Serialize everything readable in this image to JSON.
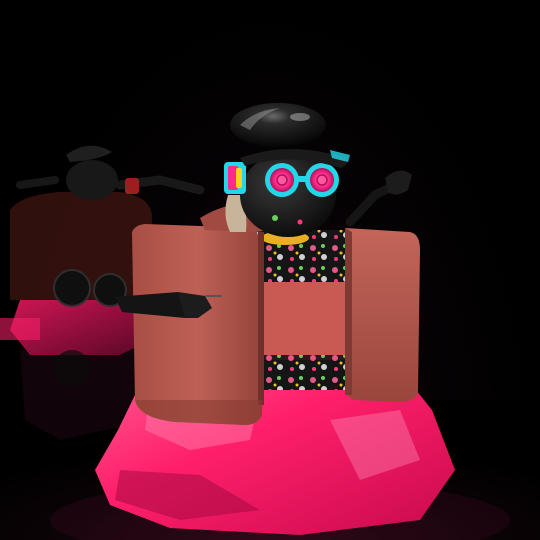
{
  "scene": {
    "background": "#000000",
    "floor_color": "#0a0a0a",
    "reflection_color": "#1a0a12"
  },
  "figure": {
    "cap_color": "#1a1a1a",
    "goggle_ring_color": "#22d8e8",
    "goggle_lens_color": "#ff2a8a",
    "visor_accent": [
      "#22d8e8",
      "#ff2a8a",
      "#ffd020"
    ],
    "jacket_color": "#b4574d",
    "jacket_shadow": "#7e3a33",
    "shirt_color": "#c85a52",
    "collar_color": "#e8b020",
    "skirt_color": "#ff1f6b",
    "skirt_highlight": "#ff86b0",
    "arm_color": "#151515"
  },
  "background_figure": {
    "jacket_color": "#3a1412",
    "skirt_color": "#c0124e"
  }
}
